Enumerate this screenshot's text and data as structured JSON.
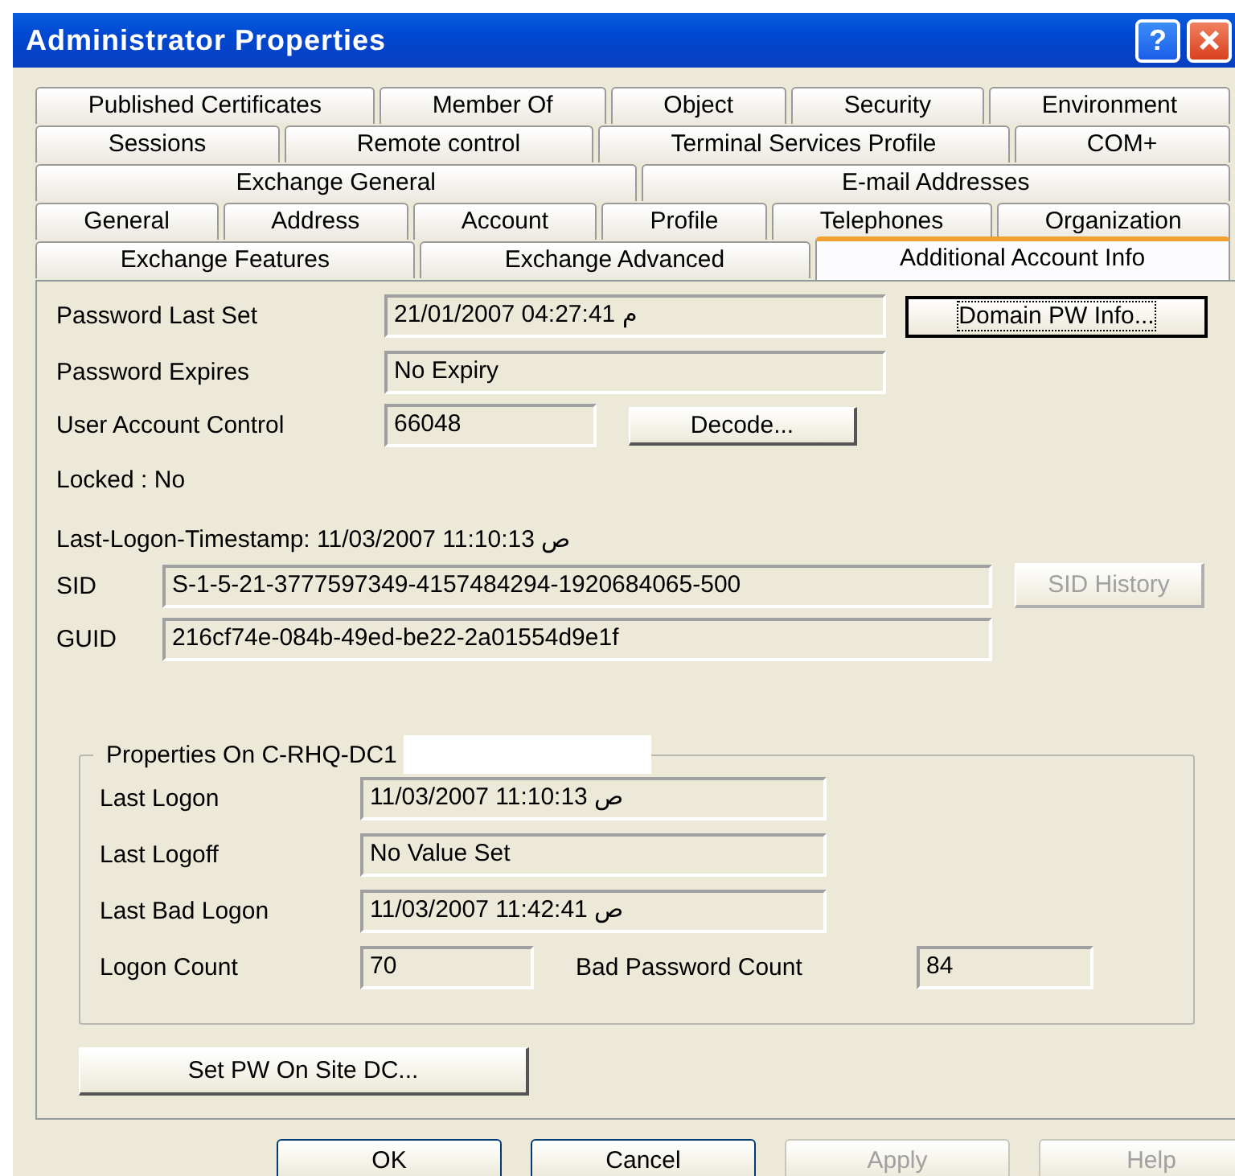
{
  "window": {
    "title": "Administrator Properties",
    "controls": [
      {
        "kind": "help",
        "label": "?"
      },
      {
        "kind": "close"
      }
    ]
  },
  "tab_rows": [
    [
      {
        "label": "Published Certificates",
        "selected": false
      },
      {
        "label": "Member Of",
        "selected": false
      },
      {
        "label": "Object",
        "selected": false
      },
      {
        "label": "Security",
        "selected": false
      },
      {
        "label": "Environment",
        "selected": false
      }
    ],
    [
      {
        "label": "Sessions",
        "selected": false
      },
      {
        "label": "Remote control",
        "selected": false
      },
      {
        "label": "Terminal Services Profile",
        "selected": false
      },
      {
        "label": "COM+",
        "selected": false
      }
    ],
    [
      {
        "label": "Exchange General",
        "selected": false
      },
      {
        "label": "E-mail Addresses",
        "selected": false
      }
    ],
    [
      {
        "label": "General",
        "selected": false
      },
      {
        "label": "Address",
        "selected": false
      },
      {
        "label": "Account",
        "selected": false
      },
      {
        "label": "Profile",
        "selected": false
      },
      {
        "label": "Telephones",
        "selected": false
      },
      {
        "label": "Organization",
        "selected": false
      }
    ],
    [
      {
        "label": "Exchange Features",
        "selected": false
      },
      {
        "label": "Exchange Advanced",
        "selected": false
      },
      {
        "label": "Additional Account Info",
        "selected": true
      }
    ]
  ],
  "password_last_set": {
    "label": "Password Last Set",
    "value": "21/01/2007 04:27:41 م",
    "button": {
      "label": "Domain PW Info...",
      "disabled": false,
      "focused": true
    }
  },
  "password_expires": {
    "label": "Password Expires",
    "value": "No Expiry"
  },
  "user_account_control": {
    "label": "User Account Control",
    "value": "66048",
    "button": {
      "label": "Decode...",
      "disabled": false,
      "focused": false
    }
  },
  "locked": "Locked : No",
  "last_logon_timestamp": "Last-Logon-Timestamp: 11/03/2007 11:10:13 ص",
  "sid": {
    "label": "SID",
    "value": "S-1-5-21-3777597349-4157484294-1920684065-500",
    "button": {
      "label": "SID History",
      "disabled": true,
      "focused": false
    }
  },
  "guid": {
    "label": "GUID",
    "value": "216cf74e-084b-49ed-be22-2a01554d9e1f"
  },
  "dc_group": {
    "title": "Properties On C-RHQ-DC1",
    "rows": [
      {
        "label": "Last Logon",
        "value": "11/03/2007 11:10:13 ص"
      },
      {
        "label": "Last Logoff",
        "value": "No Value Set"
      },
      {
        "label": "Last Bad Logon",
        "value": "11/03/2007 11:42:41 ص"
      }
    ],
    "logon_count": {
      "label": "Logon Count",
      "value": "70"
    },
    "bad_password_count": {
      "label": "Bad Password Count",
      "value": "84"
    }
  },
  "set_pw_button": {
    "label": "Set PW On Site DC...",
    "disabled": false,
    "focused": false
  },
  "dialog_buttons": [
    {
      "label": "OK",
      "disabled": false,
      "focused": false
    },
    {
      "label": "Cancel",
      "disabled": false,
      "focused": false
    },
    {
      "label": "Apply",
      "disabled": true,
      "focused": false
    },
    {
      "label": "Help",
      "disabled": true,
      "focused": false
    }
  ]
}
